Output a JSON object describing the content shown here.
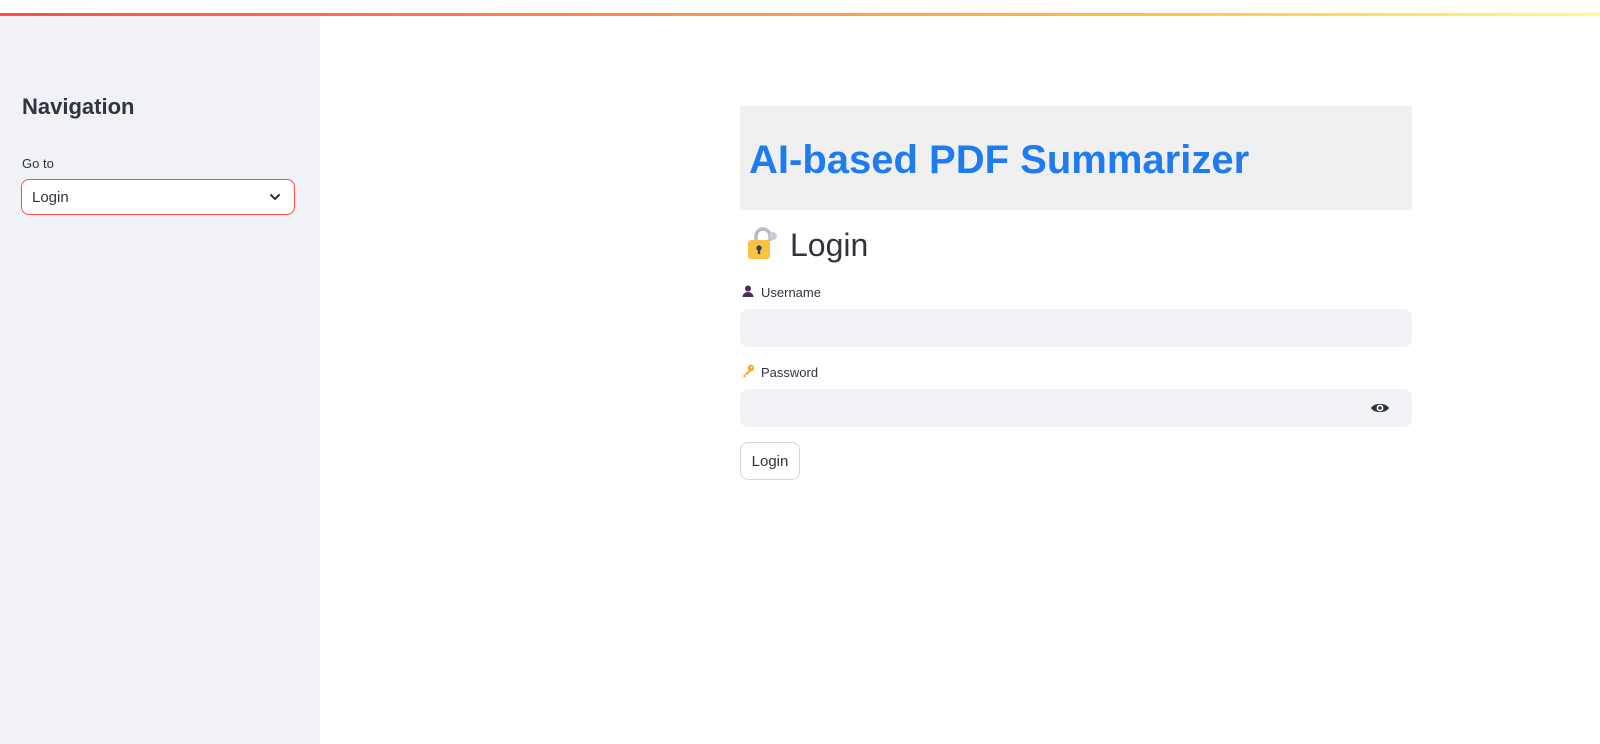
{
  "sidebar": {
    "title": "Navigation",
    "goto_label": "Go to",
    "select_value": "Login",
    "select_icon": "chevron-down-icon"
  },
  "header": {
    "app_title": "AI-based PDF Summarizer"
  },
  "login": {
    "heading": "Login",
    "heading_icon": "lock-icon",
    "username_label": "Username",
    "username_icon": "user-icon",
    "username_value": "",
    "password_label": "Password",
    "password_icon": "key-icon",
    "password_value": "",
    "password_toggle_icon": "eye-icon",
    "submit_label": "Login"
  },
  "colors": {
    "accent": "#ff4b4b",
    "title_blue": "#1f7bf0",
    "sidebar_bg": "#f0f2f6",
    "text": "#31333f"
  }
}
